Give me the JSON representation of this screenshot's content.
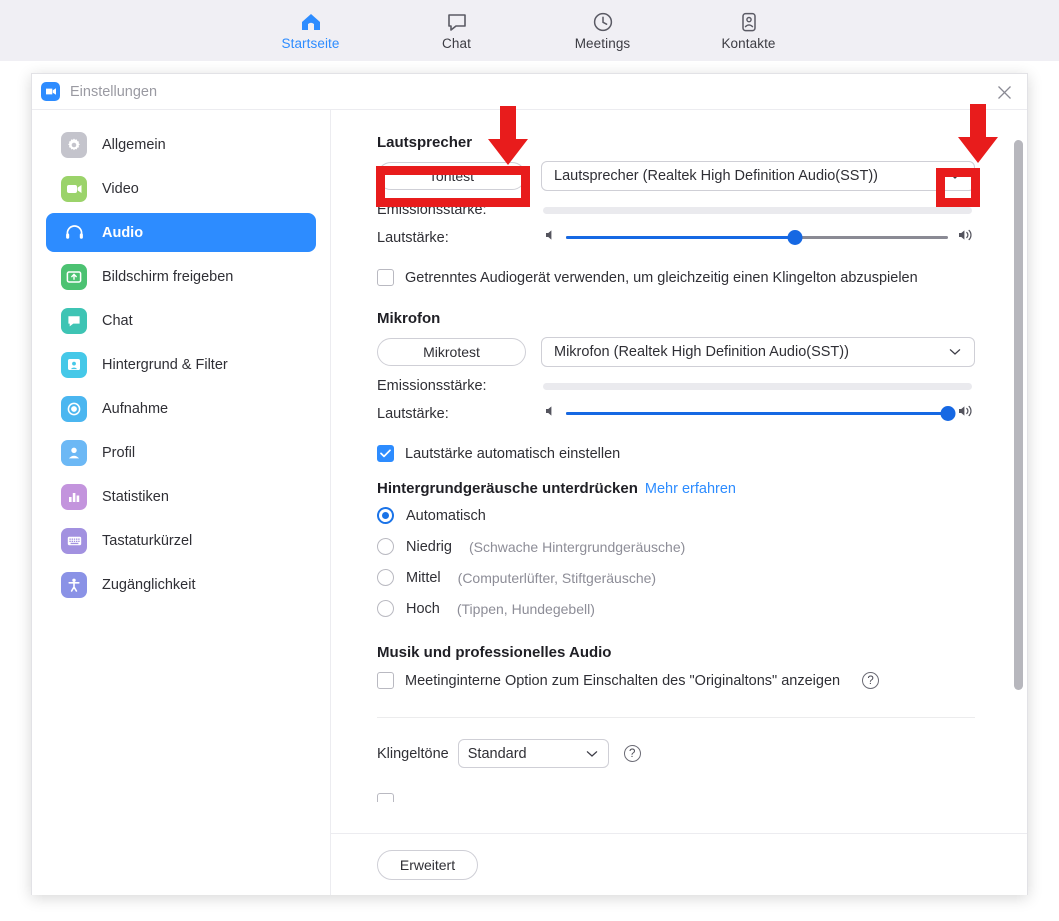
{
  "app": {
    "nav": [
      {
        "label": "Startseite",
        "icon": "home-icon",
        "active": true
      },
      {
        "label": "Chat",
        "icon": "chat-bubble-icon",
        "active": false
      },
      {
        "label": "Meetings",
        "icon": "clock-icon",
        "active": false
      },
      {
        "label": "Kontakte",
        "icon": "contact-card-icon",
        "active": false
      }
    ]
  },
  "dialog": {
    "title": "Einstellungen",
    "logo_icon": "zoom-video-icon",
    "close_icon": "close-icon"
  },
  "sidebar": {
    "items": [
      {
        "label": "Allgemein",
        "icon": "gear-icon",
        "color": "#c4c4cc",
        "active": false
      },
      {
        "label": "Video",
        "icon": "video-camera-icon",
        "color": "#9bd36a",
        "active": false
      },
      {
        "label": "Audio",
        "icon": "headphones-icon",
        "color": "#2d8cff",
        "active": true
      },
      {
        "label": "Bildschirm freigeben",
        "icon": "screen-share-icon",
        "color": "#4cc272",
        "active": false
      },
      {
        "label": "Chat",
        "icon": "chat-bubble-icon",
        "color": "#3ec4b4",
        "active": false
      },
      {
        "label": "Hintergrund & Filter",
        "icon": "person-frame-icon",
        "color": "#45c8e8",
        "active": false
      },
      {
        "label": "Aufnahme",
        "icon": "record-circle-icon",
        "color": "#4bb6f0",
        "active": false
      },
      {
        "label": "Profil",
        "icon": "person-icon",
        "color": "#6cb8f5",
        "active": false
      },
      {
        "label": "Statistiken",
        "icon": "bar-chart-icon",
        "color": "#c394dd",
        "active": false
      },
      {
        "label": "Tastaturkürzel",
        "icon": "keyboard-icon",
        "color": "#a291e0",
        "active": false
      },
      {
        "label": "Zugänglichkeit",
        "icon": "accessibility-icon",
        "color": "#8a92e6",
        "active": false
      }
    ]
  },
  "audio": {
    "speaker": {
      "heading": "Lautsprecher",
      "test_button": "Tontest",
      "device": "Lautsprecher (Realtek High Definition Audio(SST))",
      "caret_icon": "chevron-down-icon",
      "level_label": "Emissionsstärke:",
      "level_value": 0,
      "volume_label": "Lautstärke:",
      "volume_value": 60,
      "volume_min_icon": "speaker-low-icon",
      "volume_max_icon": "speaker-high-icon",
      "separate_device_checkbox": {
        "label": "Getrenntes Audiogerät verwenden, um gleichzeitig einen Klingelton abzuspielen",
        "checked": false
      }
    },
    "microphone": {
      "heading": "Mikrofon",
      "test_button": "Mikrotest",
      "device": "Mikrofon (Realtek High Definition Audio(SST))",
      "caret_icon": "chevron-down-icon",
      "level_label": "Emissionsstärke:",
      "level_value": 0,
      "volume_label": "Lautstärke:",
      "volume_value": 100,
      "volume_min_icon": "speaker-low-icon",
      "volume_max_icon": "speaker-high-icon",
      "auto_volume_checkbox": {
        "label": "Lautstärke automatisch einstellen",
        "checked": true
      }
    },
    "background_noise": {
      "heading": "Hintergrundgeräusche unterdrücken",
      "learn_more": "Mehr erfahren",
      "options": [
        {
          "label": "Automatisch",
          "hint": "",
          "selected": true
        },
        {
          "label": "Niedrig",
          "hint": "(Schwache Hintergrundgeräusche)",
          "selected": false
        },
        {
          "label": "Mittel",
          "hint": "(Computerlüfter, Stiftgeräusche)",
          "selected": false
        },
        {
          "label": "Hoch",
          "hint": "(Tippen, Hundegebell)",
          "selected": false
        }
      ]
    },
    "music_pro": {
      "heading": "Musik und professionelles Audio",
      "original_sound_checkbox": {
        "label": "Meetinginterne Option zum Einschalten des \"Originaltons\" anzeigen",
        "checked": false,
        "help_icon": "question-mark-icon",
        "help_glyph": "?"
      }
    },
    "ringtone": {
      "label": "Klingeltöne",
      "value": "Standard",
      "caret_icon": "chevron-down-icon",
      "help_icon": "question-mark-icon",
      "help_glyph": "?"
    },
    "advanced_button": "Erweitert"
  },
  "annotations": {
    "color": "#e81c1c",
    "items": [
      {
        "name": "arrow-to-tontest",
        "icon": "down-arrow-annotation"
      },
      {
        "name": "box-around-tontest",
        "icon": "rectangle-annotation"
      },
      {
        "name": "arrow-to-speaker-caret",
        "icon": "down-arrow-annotation"
      },
      {
        "name": "box-around-speaker-caret",
        "icon": "rectangle-annotation"
      }
    ]
  }
}
